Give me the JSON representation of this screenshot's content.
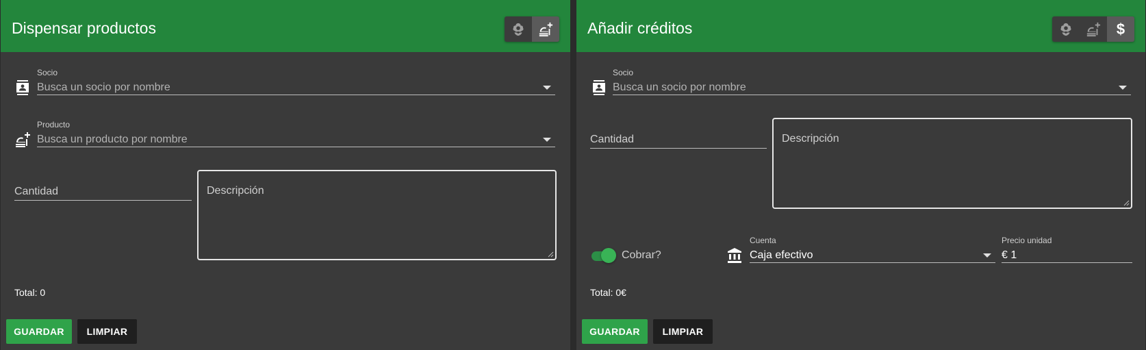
{
  "left": {
    "title": "Dispensar productos",
    "toggle_icons": [
      "grow-icon",
      "food-add-icon"
    ],
    "socio": {
      "label": "Socio",
      "placeholder": "Busca un socio por nombre"
    },
    "producto": {
      "label": "Producto",
      "placeholder": "Busca un producto por nombre"
    },
    "cantidad": "Cantidad",
    "descripcion": "Descripción",
    "total": "Total: 0",
    "save": "GUARDAR",
    "clear": "LIMPIAR"
  },
  "right": {
    "title": "Añadir créditos",
    "toggle_icons": [
      "grow-icon",
      "food-add-icon",
      "dollar-icon"
    ],
    "dollar_glyph": "$",
    "socio": {
      "label": "Socio",
      "placeholder": "Busca un socio por nombre"
    },
    "cantidad": "Cantidad",
    "descripcion": "Descripción",
    "cobrar": {
      "label": "Cobrar?",
      "checked": true
    },
    "cuenta": {
      "label": "Cuenta",
      "value": "Caja efectivo"
    },
    "precio": {
      "label": "Precio unidad",
      "prefix": "€",
      "value": "1"
    },
    "total": "Total: 0€",
    "save": "GUARDAR",
    "clear": "LIMPIAR"
  },
  "colors": {
    "header": "#23863c",
    "panel": "#3a3a3a",
    "save_button": "#2fa34a",
    "clear_button": "#1f1f1f"
  }
}
